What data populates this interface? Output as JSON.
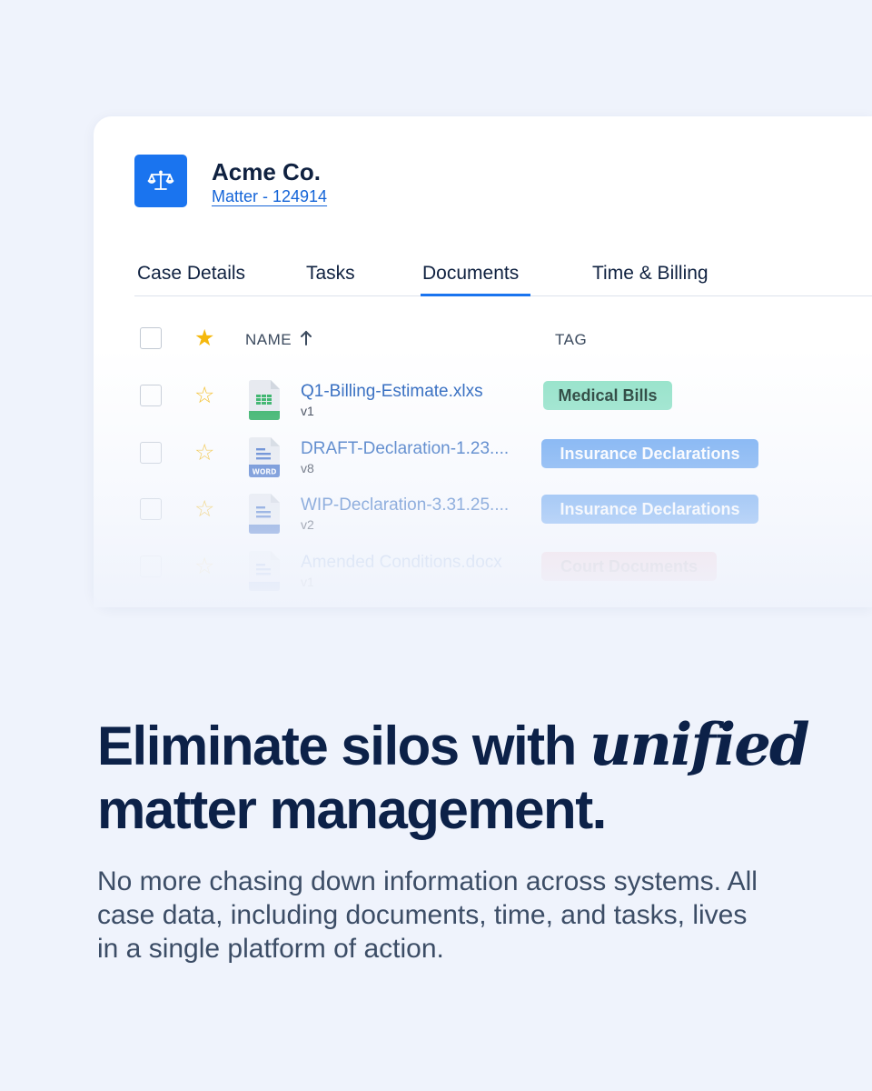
{
  "colors": {
    "background": "#eff3fc",
    "accent": "#1a74ef",
    "heading": "#0c2148",
    "star": "#f5b80c"
  },
  "header": {
    "icon": "scales-of-justice-icon",
    "client_name": "Acme Co.",
    "matter_label": "Matter - 124914"
  },
  "tabs": [
    {
      "label": "Case Details",
      "active": false
    },
    {
      "label": "Tasks",
      "active": false
    },
    {
      "label": "Documents",
      "active": true
    },
    {
      "label": "Time & Billing",
      "active": false
    }
  ],
  "table": {
    "columns": {
      "name": "NAME",
      "sort_icon": "arrow-up-icon",
      "tag": "TAG"
    },
    "rows": [
      {
        "file": "Q1-Billing-Estimate.xlxs",
        "version": "v1",
        "icon": "spreadsheet-file-icon",
        "tag": "Medical Bills"
      },
      {
        "file": "DRAFT-Declaration-1.23....",
        "version": "v8",
        "icon": "word-document-icon",
        "icon_label": "WORD",
        "tag": "Insurance Declarations"
      },
      {
        "file": "WIP-Declaration-3.31.25....",
        "version": "v2",
        "icon": "document-file-icon",
        "tag": "Insurance Declarations"
      },
      {
        "file": "Amended Conditions.docx",
        "version": "v1",
        "icon": "document-file-icon",
        "tag": "Court Documents"
      }
    ]
  },
  "marketing": {
    "headline_start": "Eliminate silos with",
    "headline_accent": "unified",
    "headline_end": "matter management.",
    "body": "No more chasing down information across systems. All case data, including documents, time, and tasks, lives in a single platform of action."
  }
}
